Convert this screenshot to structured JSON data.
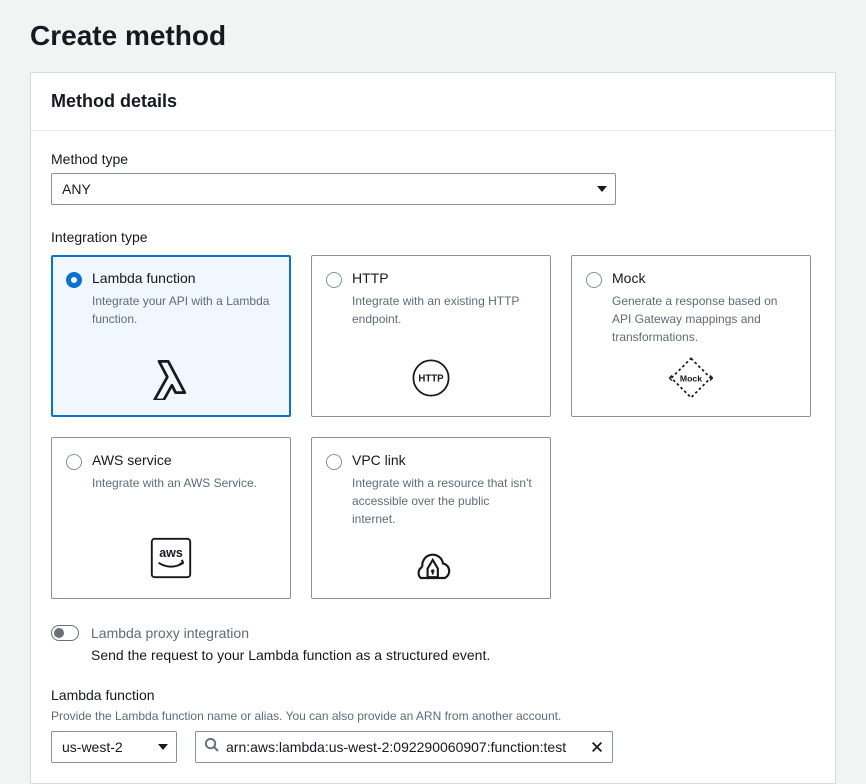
{
  "page": {
    "title": "Create method"
  },
  "panel": {
    "heading": "Method details"
  },
  "method_type": {
    "label": "Method type",
    "value": "ANY"
  },
  "integration_type": {
    "label": "Integration type",
    "options": [
      {
        "title": "Lambda function",
        "desc": "Integrate your API with a Lambda function.",
        "selected": true
      },
      {
        "title": "HTTP",
        "desc": "Integrate with an existing HTTP endpoint.",
        "selected": false
      },
      {
        "title": "Mock",
        "desc": "Generate a response based on API Gateway mappings and transformations.",
        "selected": false
      },
      {
        "title": "AWS service",
        "desc": "Integrate with an AWS Service.",
        "selected": false
      },
      {
        "title": "VPC link",
        "desc": "Integrate with a resource that isn't accessible over the public internet.",
        "selected": false
      }
    ]
  },
  "proxy": {
    "label": "Lambda proxy integration",
    "desc": "Send the request to your Lambda function as a structured event.",
    "enabled": false
  },
  "lambda_function": {
    "label": "Lambda function",
    "help": "Provide the Lambda function name or alias. You can also provide an ARN from another account.",
    "region": "us-west-2",
    "value": "arn:aws:lambda:us-west-2:092290060907:function:test"
  }
}
